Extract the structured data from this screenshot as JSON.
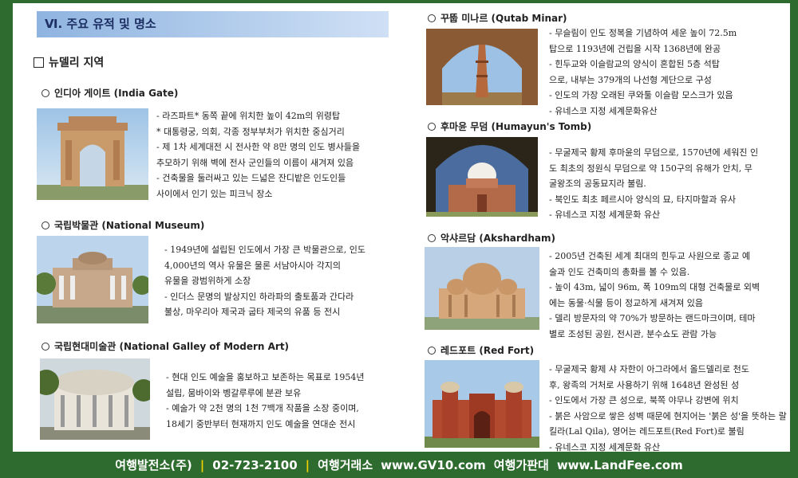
{
  "section_title": "Ⅵ. 주요 유적 및 명소",
  "region_title": "뉴델리 지역",
  "sites": [
    {
      "title": "인디아 게이트 (India Gate)",
      "lines": [
        "- 라즈파트* 동쪽 끝에 위치한 높이 42m의 위령탑",
        "  * 대통령궁, 의회, 각종 정부부처가 위치한 중심거리",
        "- 제 1차 세계대전 시 전사한 약 8만 명의 인도 병사들을",
        "  추모하기 위해 벽에 전사 군인들의 이름이 새겨져 있음",
        "- 건축물을 둘러싸고 있는 드넓은 잔디밭은 인도인들",
        "  사이에서 인기 있는 피크닉 장소"
      ]
    },
    {
      "title": "국립박물관 (National Museum)",
      "lines": [
        "- 1949년에 설립된 인도에서 가장 큰 박물관으로, 인도",
        "  4,000년의 역사 유물은 물론 서남아시아 각지의",
        "  유물을 광범위하게 소장",
        "- 인더스 문명의 발상지인 하라파의 출토품과 간다라",
        "  불상, 마우리아 제국과 굽타 제국의 유품 등 전시"
      ]
    },
    {
      "title": "국립현대미술관 (National Galley of Modern Art)",
      "lines": [
        "- 현대 인도 예술을 홍보하고 보존하는 목표로 1954년",
        "  설립, 뭄바이와 벵갈루루에 분관 보유",
        "- 예술가 약 2천 명의 1천 7백개 작품을 소장 중이며,",
        "  18세기 중반부터 현재까지 인도 예술을 연대순 전시"
      ]
    },
    {
      "title": "꾸뚭 미나르 (Qutab Minar)",
      "lines": [
        "- 무슬림이 인도 정복을 기념하여 세운 높이 72.5m",
        "  탑으로 1193년에 건립을 시작 1368년에 완공",
        "- 힌두교와 이슬람교의 양식이 혼합된 5층 석탑",
        "  으로, 내부는 379개의 나선형 계단으로 구성",
        "- 인도의 가장 오래된 쿠와툴 이슬람 모스크가 있음",
        "- 유네스코 지정 세계문화유산"
      ]
    },
    {
      "title": "후마윤 무덤 (Humayun's Tomb)",
      "lines": [
        "- 무굴제국 황제 후마윤의 무덤으로, 1570년에 세워진 인",
        "  도 최초의 정원식 무덤으로 약 150구의 유해가 안치, 무",
        "  굴왕조의 공동묘지라 불림.",
        "- 북인도 최초 페르시아 양식의 묘, 타지마할과 유사",
        "- 유네스코 지정 세계문화 유산"
      ]
    },
    {
      "title": "악샤르담 (Akshardham)",
      "lines": [
        "- 2005년 건축된 세계 최대의 힌두교 사원으로 종교 예",
        "  술과 인도 건축미의 총화를 볼 수 있음.",
        "- 높이 43m, 넓이 96m, 폭 109m의 대형 건축물로 외벽",
        "  에는 동물·식물 등이 정교하게 새겨져 있음",
        "- 델리 방문자의 약 70%가 방문하는 랜드마크이며, 테마",
        "  별로 조성된 공원, 전시관, 분수쇼도 관람 가능"
      ]
    },
    {
      "title": "레드포트 (Red Fort)",
      "lines": [
        "- 무굴제국 황제 샤 자한이 아그라에서 올드델리로 천도",
        "  후, 왕족의 거처로 사용하기 위해 1648년 완성된 성",
        "- 인도에서 가장 큰 성으로, 북쪽 야무나 강변에 위치",
        "- 붉은 사암으로 쌓은 성벽 때문에 현지어는 '붉은 성'을 뜻하는 랄",
        "  킬라(Lal Qila), 영어는 레드포트(Red Fort)로 불림",
        "- 유네스코 지정 세계문화 유산"
      ]
    }
  ],
  "footer": {
    "company": "여행발전소(주)",
    "phone": "02-723-2100",
    "brand1": "여행거래소",
    "url1": "www.GV10.com",
    "brand2": "여행가판대",
    "url2": "www.LandFee.com"
  }
}
